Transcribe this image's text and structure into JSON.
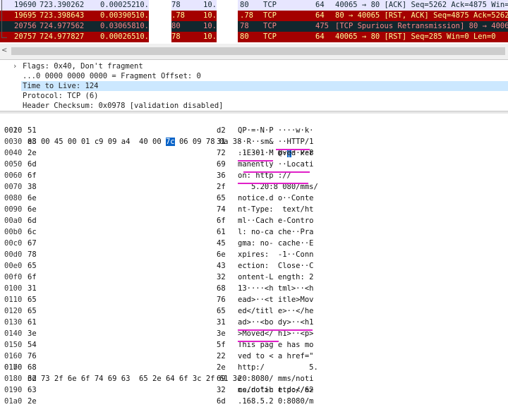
{
  "packet_list": {
    "rows": [
      {
        "no": "19690",
        "time": "723.390262",
        "delta": "0.000252",
        "src": "10.",
        "srcTail": "78",
        "dst": "10.",
        "dstTail": "80",
        "proto": "TCP",
        "len": "64",
        "info": "40065 → 80 [ACK] Seq=5262 Ack=4875 Win=26112",
        "bg": "#e7e6ff",
        "fg": "#12272e"
      },
      {
        "no": "19695",
        "time": "723.398643",
        "delta": "0.003905",
        "src": "10.",
        "srcTail": ".78",
        "dst": "10.",
        "dstTail": ".78",
        "proto": "TCP",
        "len": "64",
        "info": "80 → 40065 [RST, ACK] Seq=4875 Ack=5262 Win=0",
        "bg": "#a40000",
        "fg": "#fffc9c"
      },
      {
        "no": "20756",
        "time": "724.977562",
        "delta": "0.030658",
        "src": "10.",
        "srcTail": "80",
        "dst": "10.",
        "dstTail": "78",
        "proto": "TCP",
        "len": "475",
        "info": "[TCP Spurious Retransmission] 80 → 40065 [FI",
        "bg": "#12272e",
        "fg": "#f78787"
      },
      {
        "no": "20757",
        "time": "724.977827",
        "delta": "0.000265",
        "src": "10.",
        "srcTail": "78",
        "dst": "10.",
        "dstTail": "80",
        "proto": "TCP",
        "len": "64",
        "info": "40065 → 80 [RST] Seq=285 Win=0 Len=0",
        "bg": "#a40000",
        "fg": "#fffc9c"
      }
    ]
  },
  "scrollbar": {
    "left_arrow": "<"
  },
  "details": {
    "flags": "Flags: 0x40, Don't fragment",
    "frag": "...0 0000 0000 0000 = Fragment Offset: 0",
    "ttl": "Time to Live: 124",
    "protocol": "Protocol: TCP (6)",
    "checksum": "Header Checksum: 0x0978 [validation disabled]",
    "expander": "›"
  },
  "bytes": {
    "first_row": {
      "offset": "0010",
      "hex_before": "08 00 45 00 01 c9 09 a4  40 00 ",
      "hex_sel": "7c",
      "hex_after": " 06 09 78 0a 38",
      "ascii_before": "··E····· @·",
      "ascii_sel": "|",
      "ascii_after": "··x·8"
    },
    "rows": [
      {
        "offset": "0020",
        "hex": "51",
        "hexr": "d2",
        "ascii": "QP·=·N·P ····w·k·"
      },
      {
        "offset": "0030",
        "hex": "a3",
        "hexr": "31",
        "ascii": "··R··sm& ··HTTP/1"
      },
      {
        "offset": "0040",
        "hex": "2e",
        "hexr": "72",
        "ascii": ".1 301 M oved Per"
      },
      {
        "offset": "0050",
        "hex": "6d",
        "hexr": "69",
        "ascii": "manently ··Locati"
      },
      {
        "offset": "0060",
        "hex": "6f",
        "hexr": "36",
        "ascii": "on: http ://"
      },
      {
        "offset": "0070",
        "hex": "38",
        "hexr": "2f",
        "ascii": "   5.20:8 080/mms/"
      },
      {
        "offset": "0080",
        "hex": "6e",
        "hexr": "65",
        "ascii": "notice.d o··Conte"
      },
      {
        "offset": "0090",
        "hex": "6e",
        "hexr": "74",
        "ascii": "nt-Type:  text/ht"
      },
      {
        "offset": "00a0",
        "hex": "6d",
        "hexr": "6f",
        "ascii": "ml··Cach e-Contro"
      },
      {
        "offset": "00b0",
        "hex": "6c",
        "hexr": "61",
        "ascii": "l: no-ca che··Pra"
      },
      {
        "offset": "00c0",
        "hex": "67",
        "hexr": "45",
        "ascii": "gma: no- cache··E"
      },
      {
        "offset": "00d0",
        "hex": "78",
        "hexr": "6e",
        "ascii": "xpires:  -1··Conn"
      },
      {
        "offset": "00e0",
        "hex": "65",
        "hexr": "43",
        "ascii": "ection:  Close··C"
      },
      {
        "offset": "00f0",
        "hex": "6f",
        "hexr": "32",
        "ascii": "ontent-L ength: 2"
      },
      {
        "offset": "0100",
        "hex": "31",
        "hexr": "68",
        "ascii": "13····<h tml>··<h"
      },
      {
        "offset": "0110",
        "hex": "65",
        "hexr": "76",
        "ascii": "ead>··<t itle>Mov"
      },
      {
        "offset": "0120",
        "hex": "65",
        "hexr": "65",
        "ascii": "ed</titl e>··</he"
      },
      {
        "offset": "0130",
        "hex": "61",
        "hexr": "31",
        "ascii": "ad>··<bo dy>··<h1"
      },
      {
        "offset": "0140",
        "hex": "3e",
        "hexr": "3e",
        "ascii": ">Moved</ h1>··<p>"
      },
      {
        "offset": "0150",
        "hex": "54",
        "hexr": "5f",
        "ascii": "This pag e has mo"
      },
      {
        "offset": "0160",
        "hex": "76",
        "hexr": "22",
        "ascii": "ved to < a href=\""
      },
      {
        "offset": "0170",
        "hex": "68",
        "hexr": "2e",
        "ascii": "http:/          5."
      },
      {
        "offset": "0180",
        "hex": "32",
        "hexr": "69",
        "ascii": "20:8080/ mms/noti"
      },
      {
        "offset": "0190",
        "hex": "63",
        "hexr": "32",
        "ascii": "ce.do\">h ttp://62"
      },
      {
        "offset": "01a0",
        "hex": "2e",
        "hexr": "6d",
        "ascii": ".168.5.2 0:8080/m"
      }
    ],
    "last_row": {
      "offset": "01b0",
      "hex": "6d 73 2f 6e 6f 74 69 63  65 2e 64 6f 3c 2f 61 3e",
      "ascii": "ms/notic e.do</a>"
    }
  },
  "colors": {
    "magenta_annotation": "#e020c8",
    "selection_blue": "#0a64c8",
    "detail_highlight": "#cce8ff"
  }
}
